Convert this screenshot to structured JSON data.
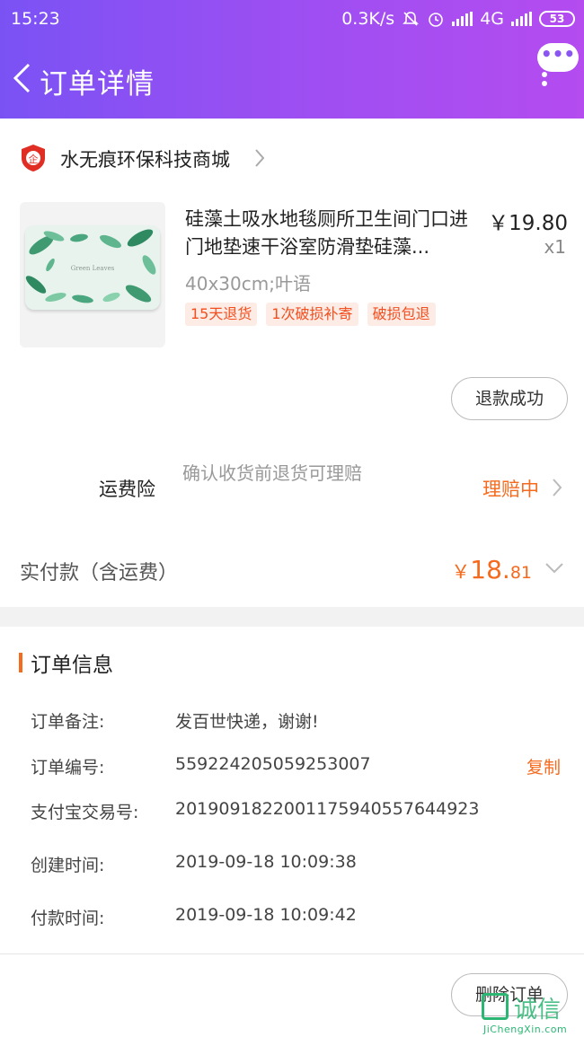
{
  "status_bar": {
    "time": "15:23",
    "network_speed": "0.3K/s",
    "network_type": "4G",
    "battery": "53"
  },
  "header": {
    "title": "订单详情",
    "menu_bubble": "•••"
  },
  "shop": {
    "logo_text": "企",
    "name": "水无痕环保科技商城"
  },
  "product": {
    "title": "硅藻土吸水地毯厕所卫生间门口进门地垫速干浴室防滑垫硅藻...",
    "price": "￥19.80",
    "quantity": "x1",
    "spec": "40x30cm;叶语",
    "image_text": "Green Leaves",
    "tags": [
      "15天退货",
      "1次破损补寄",
      "破损包退"
    ],
    "refund_status": "退款成功"
  },
  "insurance": {
    "label": "运费险",
    "description": "确认收货前退货可理赔",
    "status": "理赔中"
  },
  "payment": {
    "label": "实付款（含运费）",
    "currency": "￥",
    "amount_int": "18.",
    "amount_dec": "81"
  },
  "order_info": {
    "heading": "订单信息",
    "note_label": "订单备注:",
    "note_value": "发百世快递，谢谢!",
    "number_label": "订单编号:",
    "number_value": "559224205059253007",
    "copy_label": "复制",
    "alipay_label": "支付宝交易号:",
    "alipay_value": "2019091822001175940557644923",
    "created_label": "创建时间:",
    "created_value": "2019-09-18 10:09:38",
    "paid_label": "付款时间:",
    "paid_value": "2019-09-18 10:09:42"
  },
  "footer": {
    "delete_label": "删除订单"
  },
  "watermark": {
    "text": "诚信",
    "sub": "JiChengXin.com"
  },
  "colors": {
    "header_start": "#7a52f4",
    "header_end": "#b44cf0",
    "accent_orange": "#f46a1e",
    "tag_red": "#f24e1e"
  }
}
